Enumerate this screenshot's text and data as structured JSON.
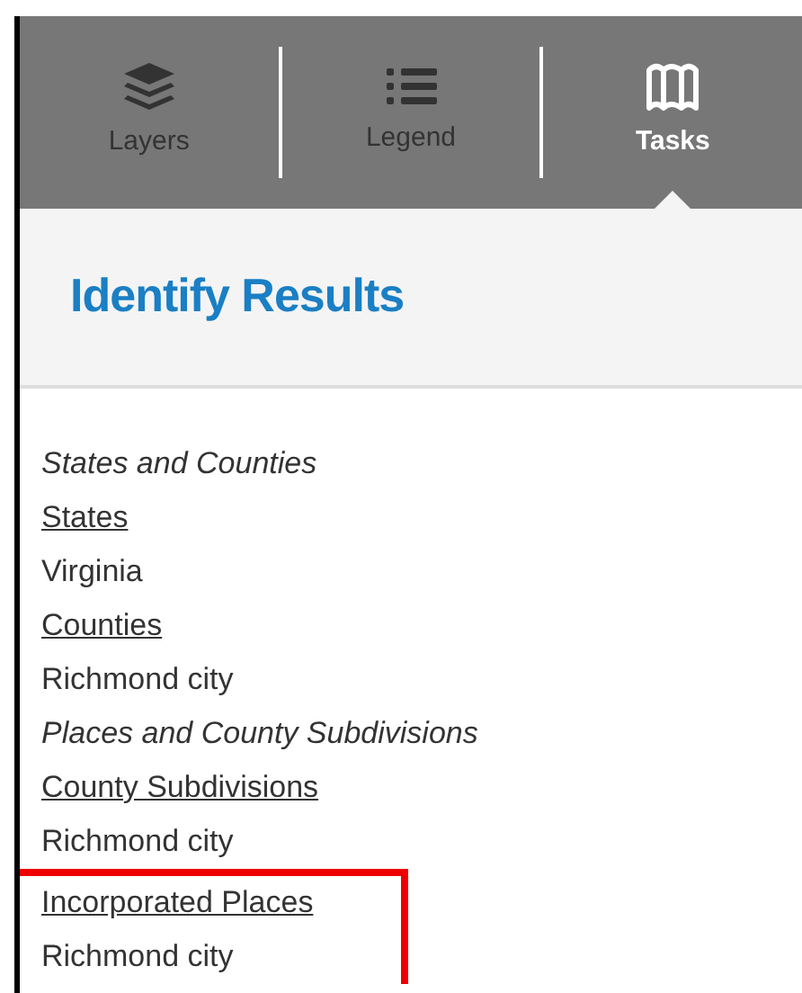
{
  "tabs": [
    {
      "label": "Layers",
      "kind": "layers",
      "selected": false
    },
    {
      "label": "Legend",
      "kind": "list",
      "selected": false
    },
    {
      "label": "Tasks",
      "kind": "map",
      "selected": true
    }
  ],
  "panel": {
    "title": "Identify Results"
  },
  "results": [
    {
      "kind": "group",
      "text": "States and Counties",
      "highlighted": false
    },
    {
      "kind": "layer",
      "text": "States",
      "highlighted": false
    },
    {
      "kind": "value",
      "text": "Virginia",
      "highlighted": false
    },
    {
      "kind": "layer",
      "text": "Counties",
      "highlighted": false
    },
    {
      "kind": "value",
      "text": "Richmond city",
      "highlighted": false
    },
    {
      "kind": "group",
      "text": "Places and County Subdivisions",
      "highlighted": false
    },
    {
      "kind": "layer",
      "text": "County Subdivisions",
      "highlighted": false
    },
    {
      "kind": "value",
      "text": "Richmond city",
      "highlighted": false
    },
    {
      "kind": "layer",
      "text": "Incorporated Places",
      "highlighted": true
    },
    {
      "kind": "value",
      "text": "Richmond city",
      "highlighted": true
    }
  ]
}
